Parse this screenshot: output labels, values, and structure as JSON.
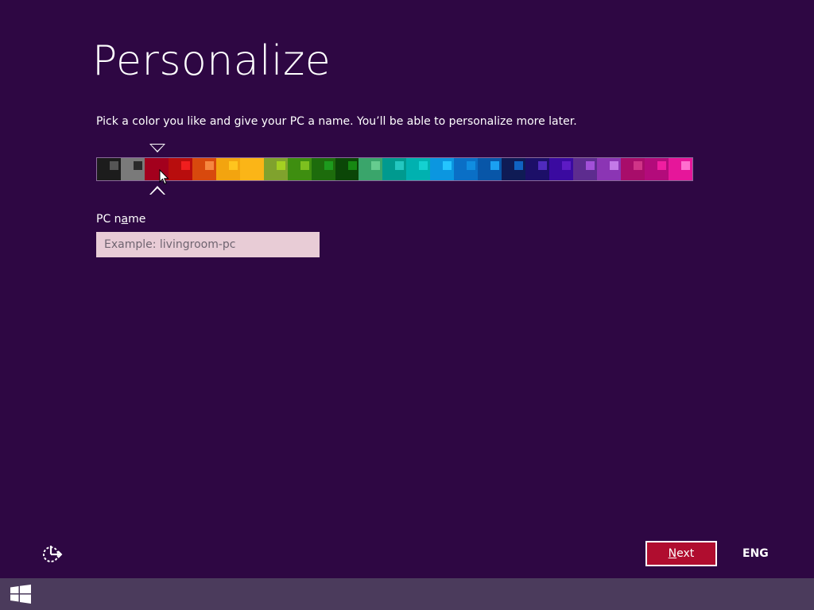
{
  "page": {
    "title": "Personalize",
    "subtitle": "Pick a color you like and give your PC a name. You’ll be able to personalize more later."
  },
  "palette": {
    "selected_index": 2,
    "swatches": [
      {
        "bg": "#1c1c1c",
        "chip": "#555555"
      },
      {
        "bg": "#7a7a7a",
        "chip": "#2a2a2a"
      },
      {
        "bg": "#a3001d",
        "chip": "#a3001d"
      },
      {
        "bg": "#b80d0d",
        "chip": "#f01e1e"
      },
      {
        "bg": "#d8490d",
        "chip": "#f6873f"
      },
      {
        "bg": "#f3a40f",
        "chip": "#ffc51e"
      },
      {
        "bg": "#fbb517",
        "chip": "#fbb517"
      },
      {
        "bg": "#80a22d",
        "chip": "#a3d021"
      },
      {
        "bg": "#3e8e10",
        "chip": "#7dc01f"
      },
      {
        "bg": "#1d6c0c",
        "chip": "#1d9a1d"
      },
      {
        "bg": "#0b4607",
        "chip": "#168712"
      },
      {
        "bg": "#3aa56b",
        "chip": "#66cc8f"
      },
      {
        "bg": "#009a8f",
        "chip": "#23c7c0"
      },
      {
        "bg": "#00b1b0",
        "chip": "#14d1d1"
      },
      {
        "bg": "#0b96e0",
        "chip": "#24c5ff"
      },
      {
        "bg": "#0a6fc6",
        "chip": "#108de0"
      },
      {
        "bg": "#0856a8",
        "chip": "#1aa0f2"
      },
      {
        "bg": "#0f1b55",
        "chip": "#1063c2"
      },
      {
        "bg": "#1c0f68",
        "chip": "#4f2bbd"
      },
      {
        "bg": "#3a0aa0",
        "chip": "#5d1bc4"
      },
      {
        "bg": "#5d2c8f",
        "chip": "#a250d8"
      },
      {
        "bg": "#8b35b4",
        "chip": "#c37ae8"
      },
      {
        "bg": "#a80d6a",
        "chip": "#d03487"
      },
      {
        "bg": "#b30b7b",
        "chip": "#f01ea0"
      },
      {
        "bg": "#e6169a",
        "chip": "#ff6fcf"
      }
    ]
  },
  "form": {
    "pc_name_label_before": "PC n",
    "pc_name_label_mnemonic": "a",
    "pc_name_label_after": "me",
    "pc_name_placeholder": "Example: livingroom-pc",
    "pc_name_value": ""
  },
  "footer": {
    "next_mnemonic": "N",
    "next_rest": "ext",
    "next_button_color": "#b00d2f",
    "language": "ENG",
    "ease_of_access_icon": "ease-of-access-icon"
  },
  "taskbar": {
    "start_icon": "windows-logo-icon"
  },
  "colors": {
    "background": "#2e0743",
    "taskbar": "#4b3b5c"
  }
}
